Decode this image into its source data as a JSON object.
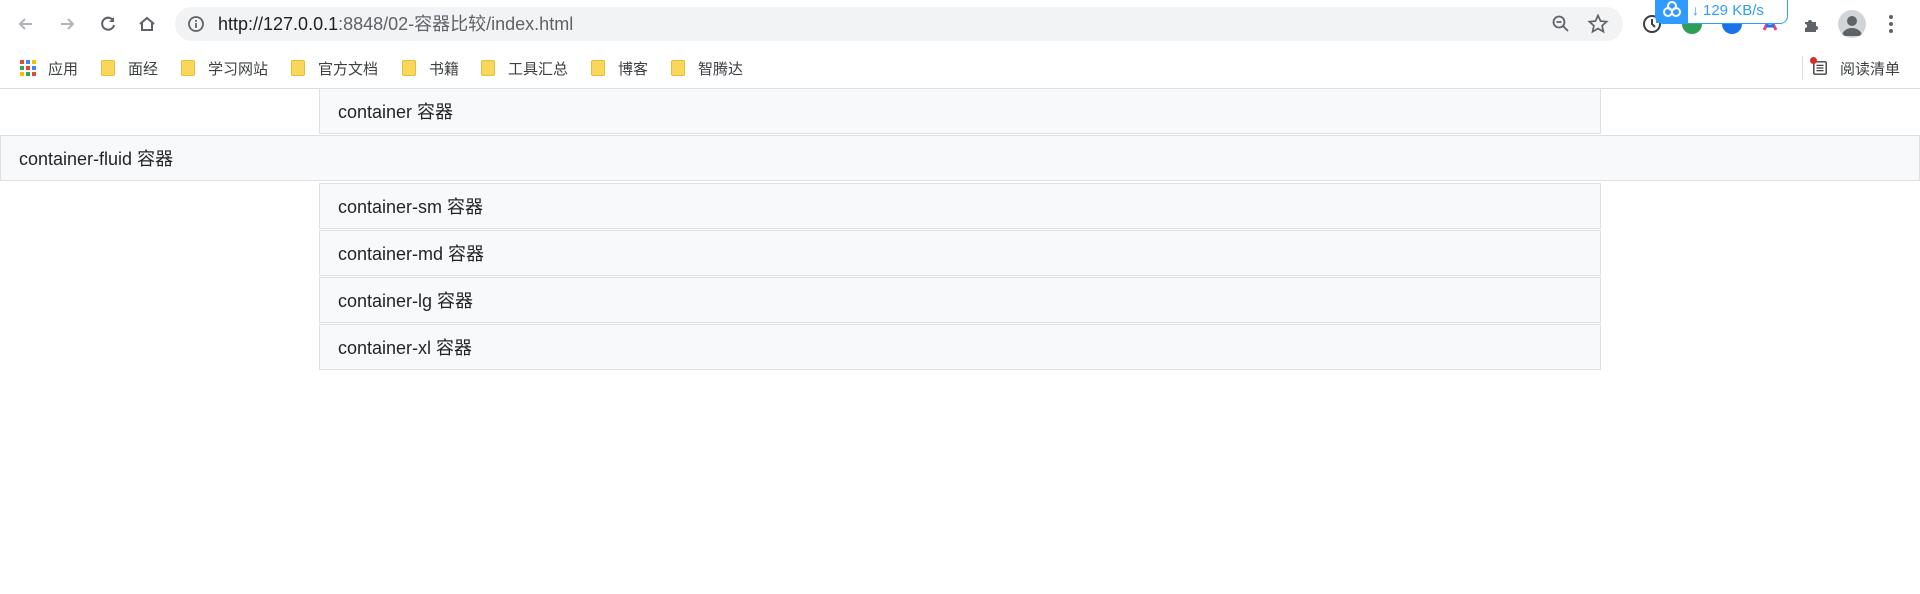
{
  "browser": {
    "url_host": "http://127.0.0.1",
    "url_path": ":8848/02-容器比较/index.html",
    "download_speed": "129 KB/s",
    "colors": {
      "accent": "#2f9bff",
      "omnibox": "#f1f3f4"
    },
    "icons": [
      "back-icon",
      "forward-icon",
      "reload-icon",
      "home-icon",
      "info-icon",
      "zoom-icon",
      "star-icon",
      "sync-icon",
      "extension-icon",
      "profile-icon",
      "menu-icon"
    ]
  },
  "bookmarks": {
    "apps_label": "应用",
    "items": [
      "面经",
      "学习网站",
      "官方文档",
      "书籍",
      "工具汇总",
      "博客",
      "智腾达"
    ],
    "reading_list": "阅读清单"
  },
  "containers": [
    {
      "label": "container 容器"
    },
    {
      "label": "container-fluid 容器"
    },
    {
      "label": "container-sm 容器"
    },
    {
      "label": "container-md 容器"
    },
    {
      "label": "container-lg 容器"
    },
    {
      "label": "container-xl 容器"
    }
  ]
}
